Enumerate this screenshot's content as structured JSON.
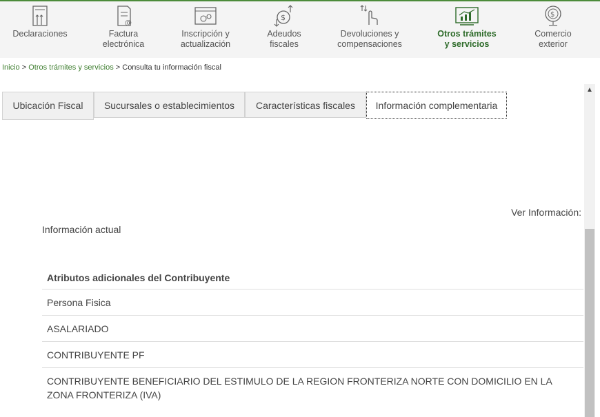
{
  "nav": {
    "items": [
      {
        "line1": "Declaraciones",
        "line2": ""
      },
      {
        "line1": "Factura",
        "line2": "electrónica"
      },
      {
        "line1": "Inscripción y",
        "line2": "actualización"
      },
      {
        "line1": "Adeudos",
        "line2": "fiscales"
      },
      {
        "line1": "Devoluciones y",
        "line2": "compensaciones"
      },
      {
        "line1": "Otros trámites",
        "line2": "y servicios"
      },
      {
        "line1": "Comercio",
        "line2": "exterior"
      }
    ],
    "active_index": 5
  },
  "breadcrumb": {
    "home": "Inicio",
    "sep1": " > ",
    "section": "Otros trámites y servicios",
    "sep2": " > ",
    "current": "Consulta tu información fiscal"
  },
  "tabs": [
    {
      "label": "Ubicación Fiscal"
    },
    {
      "label": "Sucursales o establecimientos"
    },
    {
      "label": "Características fiscales"
    },
    {
      "label": "Información complementaria"
    }
  ],
  "selected_tab": 3,
  "content": {
    "ver_info": "Ver Información:",
    "info_actual": "Información actual",
    "table_header": "Atributos adicionales del Contribuyente",
    "rows": [
      "Persona Fisica",
      "ASALARIADO",
      "CONTRIBUYENTE PF",
      "CONTRIBUYENTE BENEFICIARIO DEL ESTIMULO DE LA REGION FRONTERIZA NORTE CON DOMICILIO EN LA ZONA FRONTERIZA (IVA)"
    ]
  },
  "colors": {
    "accent_green": "#2e6b2a",
    "link_green": "#3d7d2e"
  },
  "icons": [
    "declaraciones-icon",
    "factura-icon",
    "inscripcion-icon",
    "adeudos-icon",
    "devoluciones-icon",
    "otros-tramites-icon",
    "comercio-exterior-icon"
  ]
}
